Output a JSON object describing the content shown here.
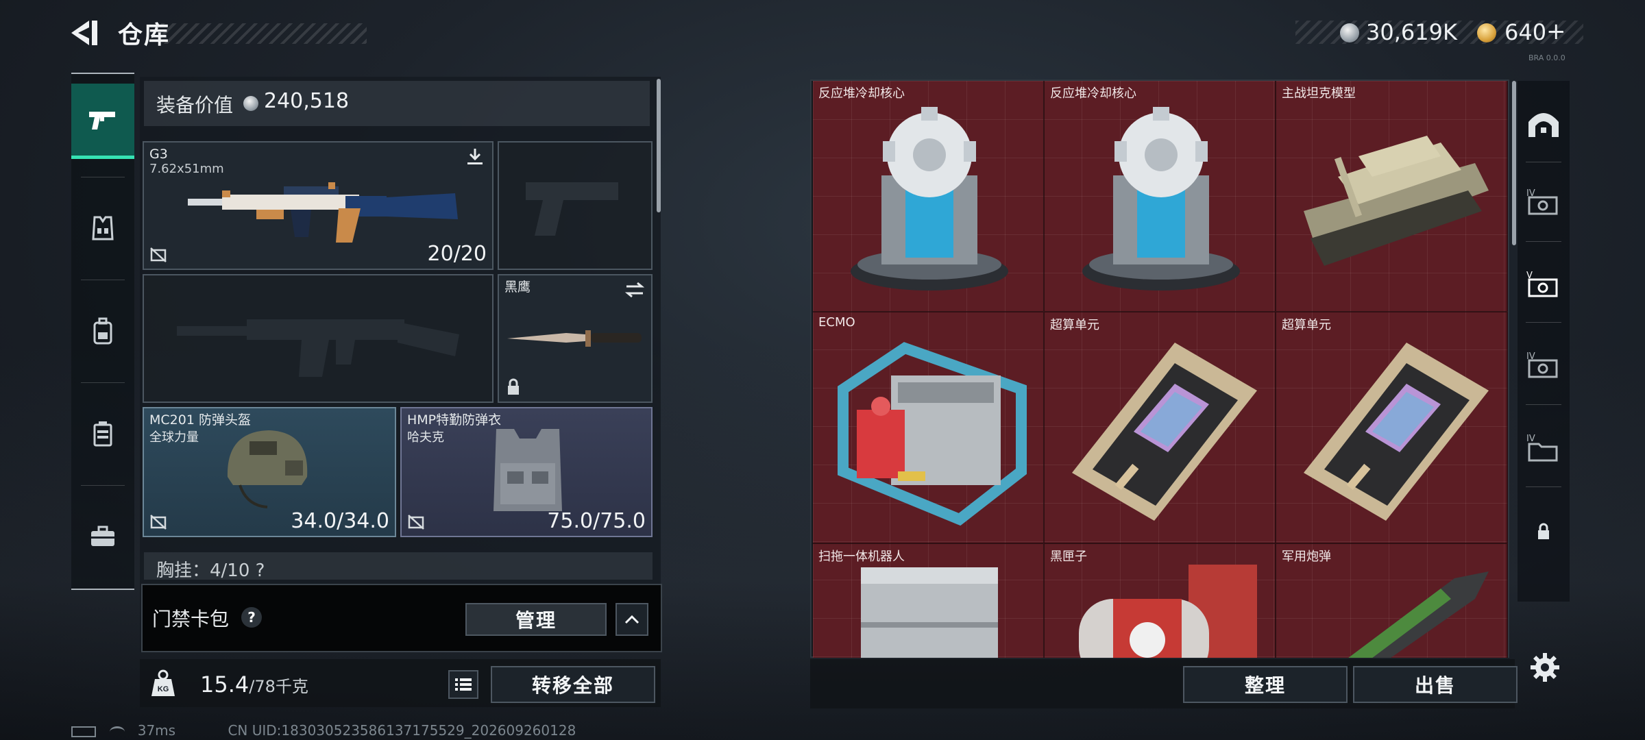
{
  "header": {
    "title": "仓库",
    "currency_primary": "30,619K",
    "currency_secondary": "640",
    "currency_secondary_plus": "+",
    "build_tag": "BRA 0.0.0"
  },
  "nav": {
    "items": [
      {
        "name": "pistol-icon",
        "active": true
      },
      {
        "name": "vest-icon",
        "active": false
      },
      {
        "name": "backpack-icon",
        "active": false
      },
      {
        "name": "rig-icon",
        "active": false
      },
      {
        "name": "briefcase-icon",
        "active": false
      }
    ]
  },
  "equipment": {
    "value_label": "装备价值",
    "value": "240,518",
    "primary_weapon": {
      "name": "G3",
      "caliber": "7.62x51mm",
      "durability": "20/20"
    },
    "knife": {
      "name": "黑鹰"
    },
    "helmet": {
      "name": "MC201 防弹头盔",
      "brand": "全球力量",
      "durability": "34.0/34.0"
    },
    "armor": {
      "name": "HMP特勤防弹衣",
      "brand": "哈夫克",
      "durability": "75.0/75.0"
    },
    "chest_rig": "胸挂：4/10 ?"
  },
  "keycard": {
    "label": "门禁卡包",
    "help": "?",
    "manage_button": "管理"
  },
  "weight": {
    "current": "15.4",
    "max": "/78千克",
    "icon_label": "KG"
  },
  "actions": {
    "transfer_all": "转移全部",
    "sort": "整理",
    "sell": "出售"
  },
  "stash": {
    "items": [
      {
        "name": "反应堆冷却核心",
        "icon": "reactor-core"
      },
      {
        "name": "反应堆冷却核心",
        "icon": "reactor-core"
      },
      {
        "name": "主战坦克模型",
        "icon": "tank-model"
      },
      {
        "name": "ECMO",
        "icon": "ecmo-machine"
      },
      {
        "name": "超算单元",
        "icon": "compute-unit"
      },
      {
        "name": "超算单元",
        "icon": "compute-unit"
      },
      {
        "name": "扫拖一体机器人",
        "icon": "robot-vacuum"
      },
      {
        "name": "黑匣子",
        "icon": "black-box"
      },
      {
        "name": "军用炮弹",
        "icon": "artillery-shell"
      }
    ]
  },
  "right_tabs": [
    {
      "name": "storage-arch-icon",
      "label": ""
    },
    {
      "name": "case-tier-icon",
      "label": "IV"
    },
    {
      "name": "case-tier-icon",
      "label": "V"
    },
    {
      "name": "case-tier-icon",
      "label": "IV"
    },
    {
      "name": "folder-tier-icon",
      "label": "IV"
    },
    {
      "name": "lock-icon",
      "label": ""
    }
  ],
  "status_bar": {
    "ping": "37ms",
    "uid": "CN UID:18303052358613717552​9_202609260128"
  }
}
